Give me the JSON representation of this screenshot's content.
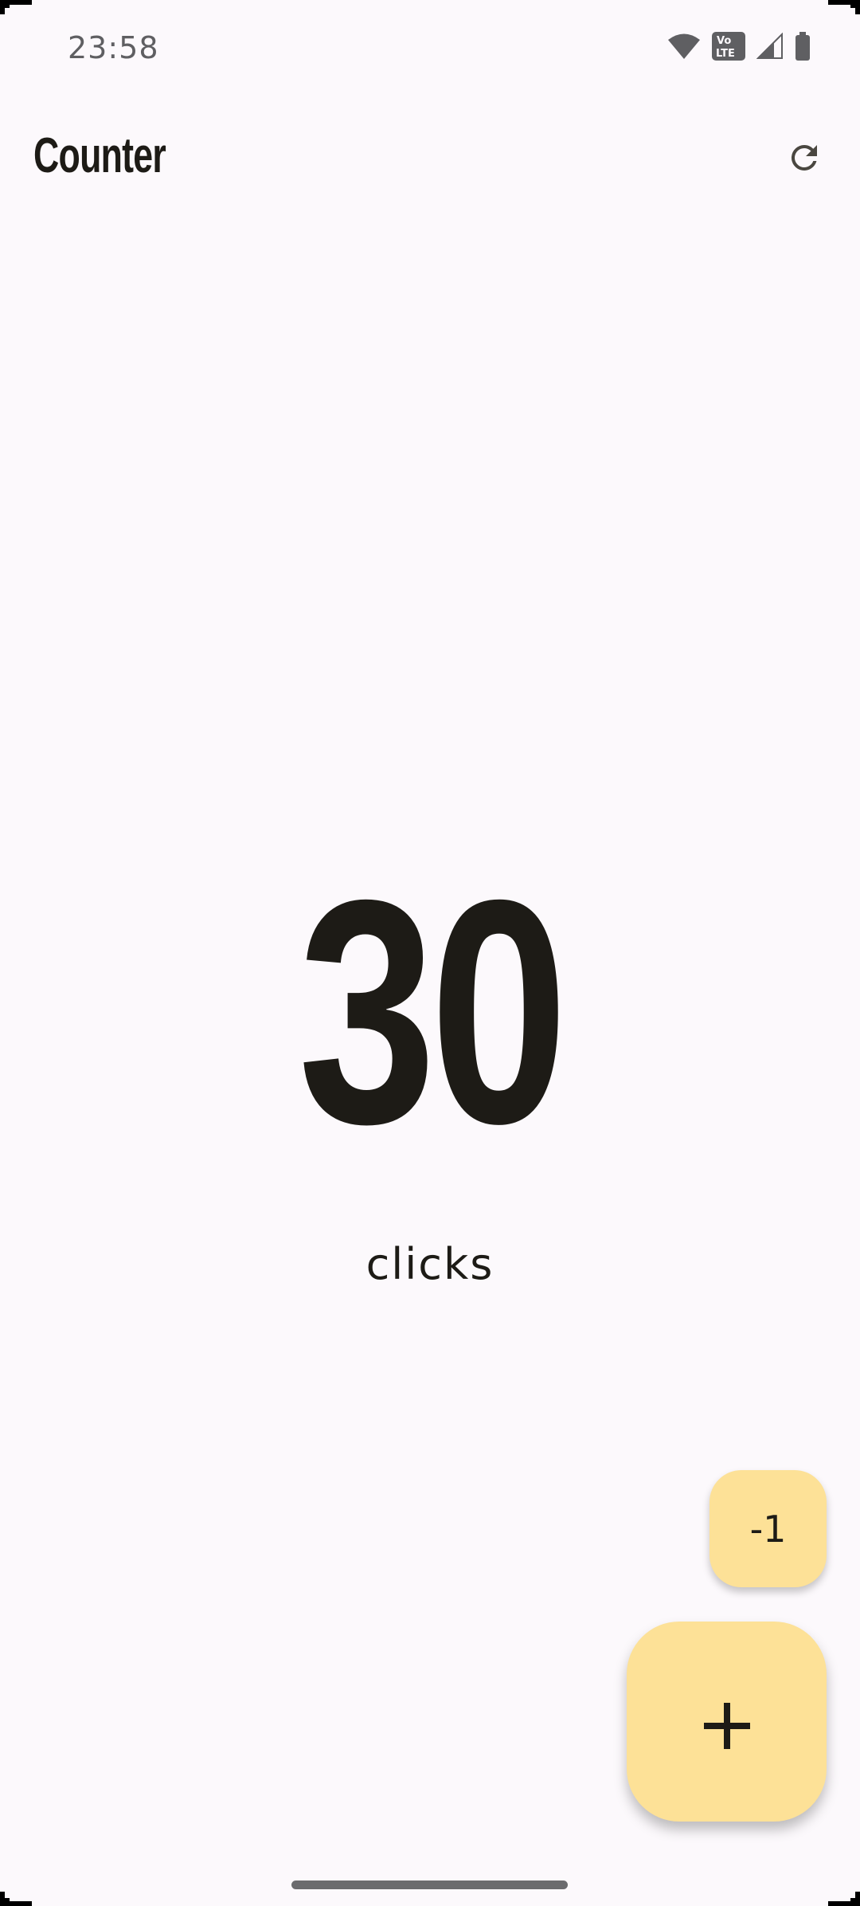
{
  "status_bar": {
    "time": "23:58",
    "icons": [
      "wifi-icon",
      "volte-icon",
      "signal-icon",
      "battery-icon"
    ],
    "volte_text_top": "Vo",
    "volte_text_bottom": "LTE"
  },
  "app_bar": {
    "title": "Counter",
    "reset_icon": "refresh-icon"
  },
  "counter": {
    "value": "30",
    "label": "clicks"
  },
  "actions": {
    "decrement_label": "-1",
    "increment_label": "+"
  },
  "colors": {
    "background": "#fcf9fc",
    "fab": "#fde197",
    "text": "#1d1b16"
  }
}
